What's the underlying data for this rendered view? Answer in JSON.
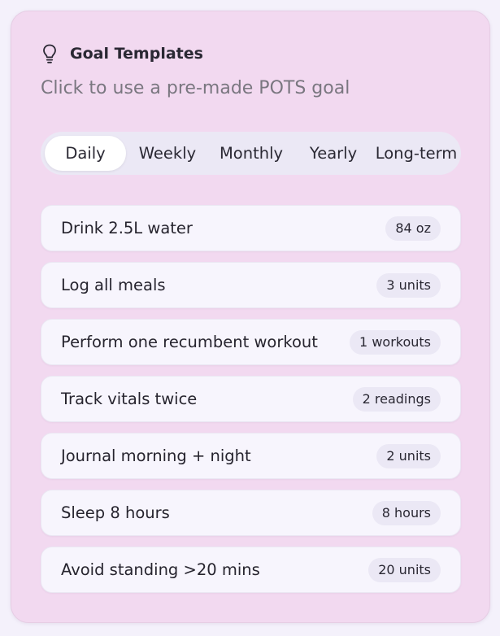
{
  "header": {
    "icon": "lightbulb-icon",
    "title": "Goal Templates",
    "subtitle": "Click to use a pre-made POTS goal"
  },
  "tabs": [
    {
      "label": "Daily",
      "active": true
    },
    {
      "label": "Weekly",
      "active": false
    },
    {
      "label": "Monthly",
      "active": false
    },
    {
      "label": "Yearly",
      "active": false
    },
    {
      "label": "Long-term",
      "active": false
    }
  ],
  "goals": [
    {
      "label": "Drink 2.5L water",
      "target": "84 oz"
    },
    {
      "label": "Log all meals",
      "target": "3 units"
    },
    {
      "label": "Perform one recumbent workout",
      "target": "1 workouts"
    },
    {
      "label": "Track vitals twice",
      "target": "2 readings"
    },
    {
      "label": "Journal morning + night",
      "target": "2 units"
    },
    {
      "label": "Sleep 8 hours",
      "target": "8 hours"
    },
    {
      "label": "Avoid standing >20 mins",
      "target": "20 units"
    }
  ],
  "colors": {
    "card_background": "#f2d9f0",
    "tab_bar_background": "#ebe8f5",
    "active_tab": "#ffffff",
    "goal_background": "#f7f5fd",
    "text": "#26242e",
    "muted_text": "#7a7780"
  }
}
